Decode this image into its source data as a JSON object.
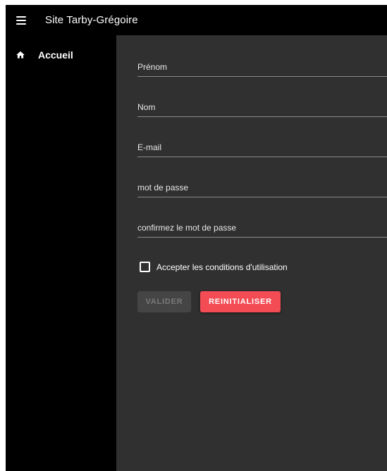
{
  "appbar": {
    "title": "Site Tarby-Grégoire",
    "menu_icon": "menu-icon"
  },
  "sidebar": {
    "items": [
      {
        "label": "Accueil",
        "icon": "home-icon"
      }
    ]
  },
  "form": {
    "fields": [
      {
        "placeholder": "Prénom",
        "value": ""
      },
      {
        "placeholder": "Nom",
        "value": ""
      },
      {
        "placeholder": "E-mail",
        "value": ""
      },
      {
        "placeholder": "mot de passe",
        "value": ""
      },
      {
        "placeholder": "confirmez le mot de passe",
        "value": ""
      }
    ],
    "terms_checkbox": {
      "label": "Accepter les conditions d'utilisation",
      "checked": false
    },
    "submit_label": "VALIDER",
    "reset_label": "REINITIALISER"
  },
  "colors": {
    "background": "#303030",
    "appbar": "#000000",
    "sidebar": "#000000",
    "accent": "#f44c55",
    "disabled_button": "#454545",
    "disabled_text": "#7a7a7a",
    "text": "#ffffff"
  }
}
